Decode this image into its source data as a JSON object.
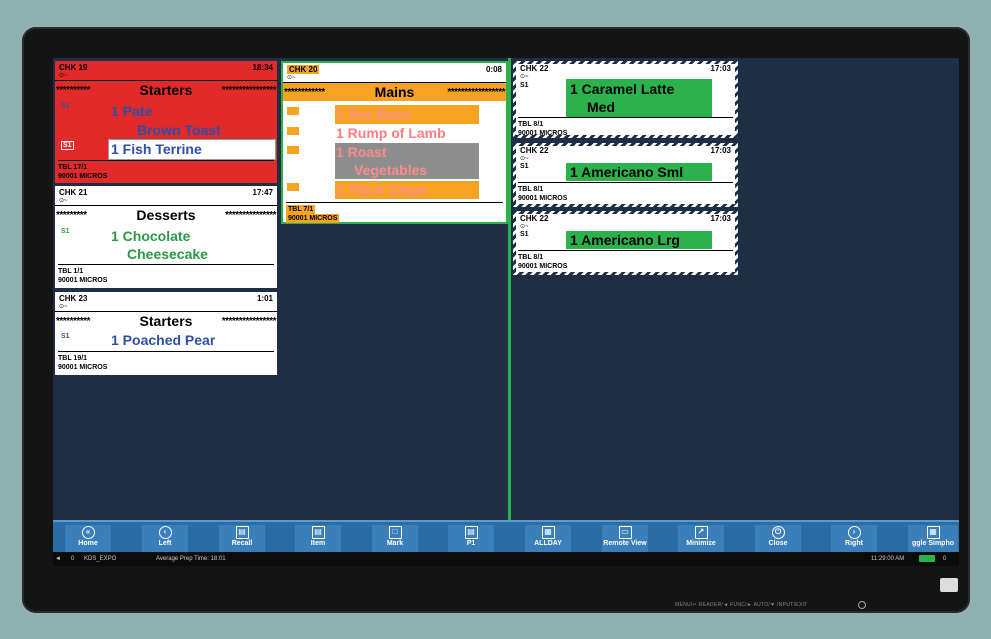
{
  "tickets": {
    "chk19": {
      "chk": "CHK 19",
      "time": "18:34",
      "sub": "⊙~",
      "course": "Starters",
      "stars_left": "**********",
      "stars_right": "****************",
      "seat1": "S1",
      "seat2": "S1",
      "item1": "1  Pate",
      "item1b": "Brown Toast",
      "item2": "1  Fish Terrine",
      "tbl": "TBL 17/1",
      "micros": "90001 MICROS"
    },
    "chk21": {
      "chk": "CHK 21",
      "time": "17:47",
      "sub": "⊙~",
      "course": "Desserts",
      "stars_left": "*********",
      "stars_right": "***************",
      "seat": "S1",
      "item": "1  Chocolate",
      "item_b": "Cheesecake",
      "tbl": "TBL 1/1",
      "micros": "90001 MICROS"
    },
    "chk23": {
      "chk": "CHK 23",
      "time": "1:01",
      "sub": "⊙~",
      "course": "Starters",
      "stars_left": "**********",
      "stars_right": "****************",
      "seat": "S1",
      "item": "1  Poached Pear",
      "tbl": "TBL 19/1",
      "micros": "90001 MICROS"
    },
    "chk20": {
      "chk": "CHK 20",
      "time": "0:08",
      "sub": "⊙~",
      "course": "Mains",
      "stars_left": "************",
      "stars_right": "*****************",
      "item1": "1  Sea Bass",
      "item2": "1  Rump of Lamb",
      "item3": "1  Roast",
      "item3b": "Vegetables",
      "item4": "1  Thick Chips",
      "tbl": "TBL 7/1",
      "micros": "90001 MICROS"
    },
    "chk22a": {
      "chk": "CHK 22",
      "time": "17:03",
      "sub": "⊙~",
      "seat": "S1",
      "item": "1  Caramel Latte",
      "item_b": "Med",
      "tbl": "TBL 8/1",
      "micros": "90001 MICROS"
    },
    "chk22b": {
      "chk": "CHK 22",
      "time": "17:03",
      "sub": "⊙~",
      "seat": "S1",
      "item": "1  Americano Sml",
      "tbl": "TBL 8/1",
      "micros": "90001 MICROS"
    },
    "chk22c": {
      "chk": "CHK 22",
      "time": "17:03",
      "sub": "⊙~",
      "seat": "S1",
      "item": "1  Americano Lrg",
      "tbl": "TBL 8/1",
      "micros": "90001 MICROS"
    }
  },
  "toolbar": {
    "buttons": [
      {
        "label": "Home",
        "icon": "«"
      },
      {
        "label": "Left",
        "icon": "‹"
      },
      {
        "label": "Recall",
        "icon": "▤"
      },
      {
        "label": "Item",
        "icon": "▤"
      },
      {
        "label": "Mark",
        "icon": "□"
      },
      {
        "label": "P1",
        "icon": "▤"
      },
      {
        "label": "ALLDAY",
        "icon": "▦"
      },
      {
        "label": "Remote View",
        "icon": "▭"
      },
      {
        "label": "Minimize",
        "icon": "↗"
      },
      {
        "label": "Close",
        "icon": "⏻"
      },
      {
        "label": "Right",
        "icon": "›"
      },
      {
        "label": "ggle Simpho",
        "icon": "▦"
      }
    ]
  },
  "status": {
    "arrow": "◄",
    "count": "0",
    "station": "KDS_EXPO",
    "prep_time": "Average Prep Time: 18:01",
    "clock": "11:29:00 AM",
    "right_count": "0"
  },
  "monitor": {
    "buttons_text": "MENU/↵  READER/◄  FUNC/►  AUTO/▼  INPUT/EXIT"
  },
  "colors": {
    "red": "#e22a2a",
    "orange": "#f6a323",
    "green": "#2bb24c",
    "blue": "#2e4fa8",
    "screen_bg": "#1e2e45"
  }
}
